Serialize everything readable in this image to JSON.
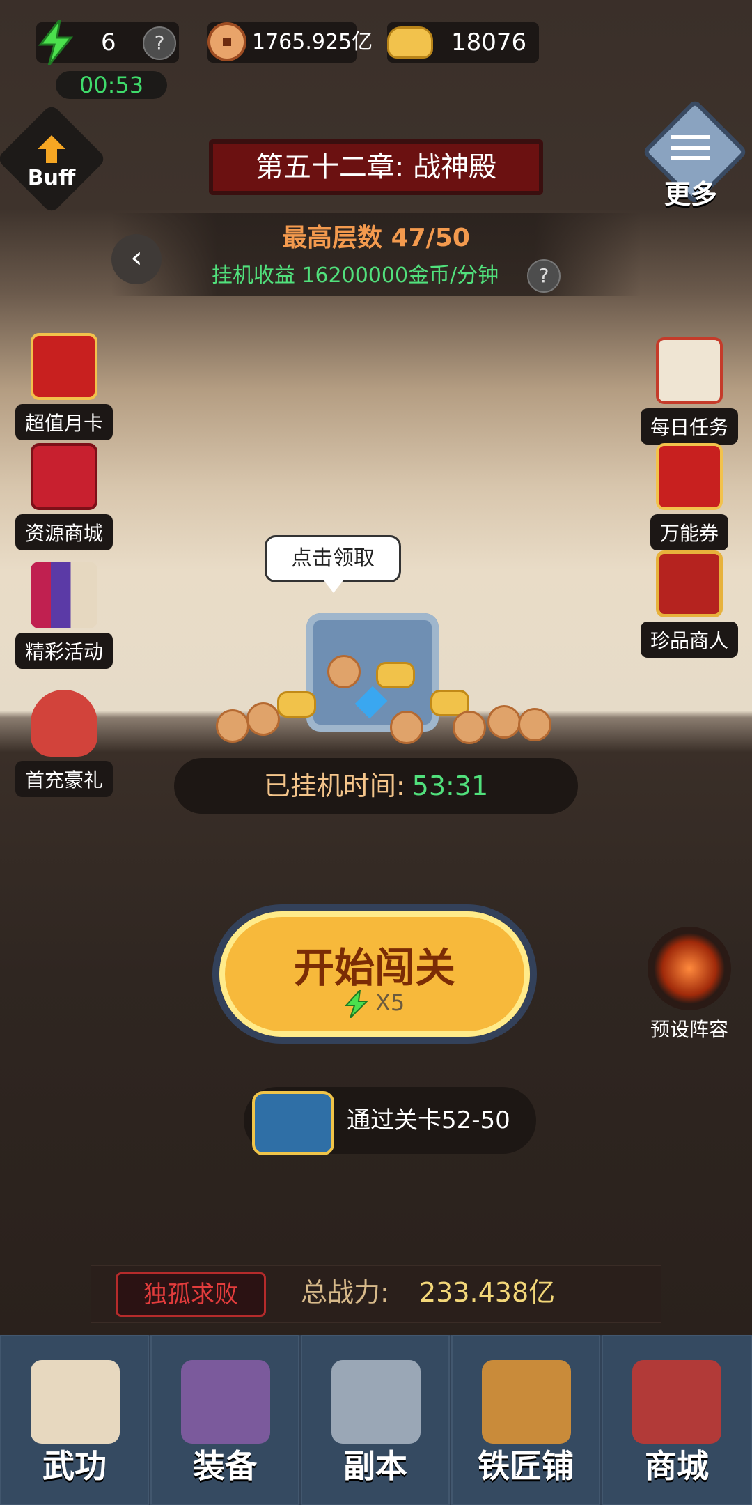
{
  "hud": {
    "energy": "6",
    "energy_timer": "00:53",
    "copper": "1765.925亿",
    "gold": "18076",
    "help_icon": "?"
  },
  "buff": {
    "label": "Buff"
  },
  "more": {
    "label": "更多"
  },
  "chapter": {
    "title": "第五十二章: 战神殿"
  },
  "floor": {
    "max_label": "最高层数 47/50",
    "income": "挂机收益 16200000金币/分钟"
  },
  "left_menu": [
    {
      "label": "超值月卡",
      "icon": "monthly-card-icon"
    },
    {
      "label": "资源商城",
      "icon": "gift-box-icon"
    },
    {
      "label": "精彩活动",
      "icon": "event-books-icon"
    },
    {
      "label": "首充豪礼",
      "icon": "money-bag-icon"
    }
  ],
  "right_menu": [
    {
      "label": "每日任务",
      "icon": "scroll-icon"
    },
    {
      "label": "万能券",
      "icon": "ticket-icon"
    },
    {
      "label": "珍品商人",
      "icon": "treasure-chest-icon"
    }
  ],
  "chest": {
    "bubble": "点击领取"
  },
  "idle": {
    "label": "已挂机时间:",
    "time": "53:31"
  },
  "start": {
    "label": "开始闯关",
    "cost": "X5"
  },
  "preset": {
    "label": "预设阵容"
  },
  "pass": {
    "label": "通过关卡52-50"
  },
  "power": {
    "badge": "独孤求败",
    "label": "总战力:",
    "value": "233.438亿"
  },
  "nav": [
    {
      "label": "武功",
      "icon": "martial-arts-scroll-icon"
    },
    {
      "label": "装备",
      "icon": "armor-icon"
    },
    {
      "label": "副本",
      "icon": "crossed-swords-icon"
    },
    {
      "label": "铁匠铺",
      "icon": "hammer-icon"
    },
    {
      "label": "商城",
      "icon": "shop-gift-icon"
    }
  ],
  "colors": {
    "accent_green": "#51e07c",
    "orange_text": "#f4a36a",
    "gold_button": "#f7b93b",
    "nav_bg": "#314257"
  }
}
